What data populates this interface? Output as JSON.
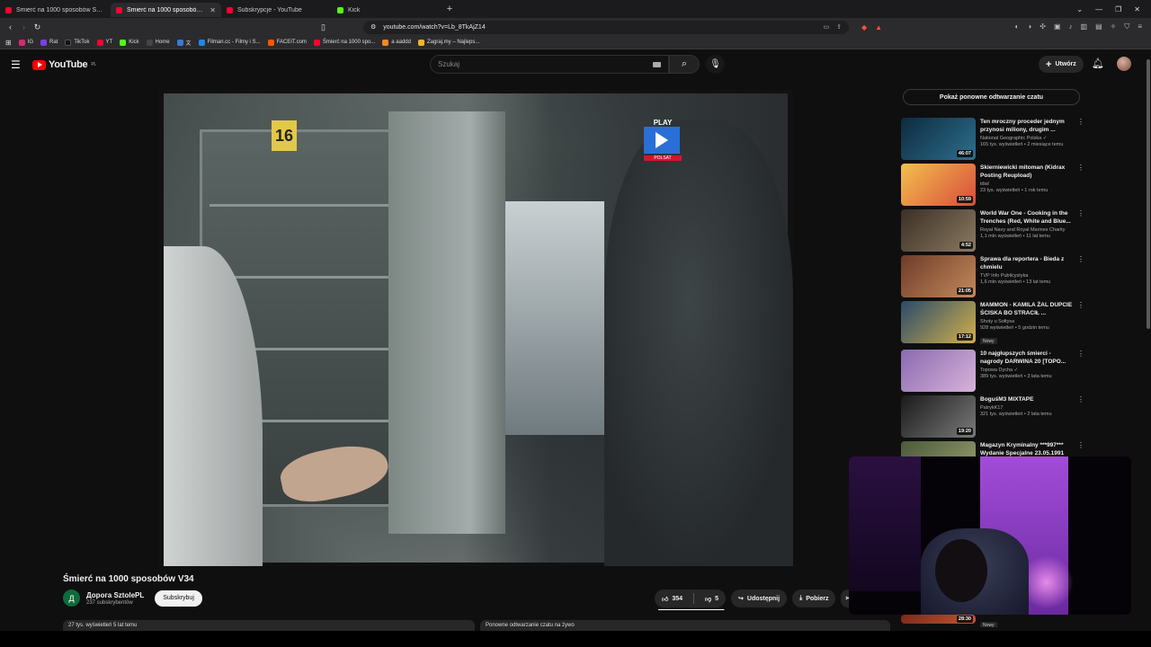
{
  "browser": {
    "tabs": [
      {
        "title": "Śmierć na 1000 sposobów S1 Odc. 2",
        "color": "#ff0033",
        "active": false
      },
      {
        "title": "Śmierć na 1000 sposobów V3",
        "color": "#ff0033",
        "active": true
      },
      {
        "title": "Subskrypcje - YouTube",
        "color": "#ff0033",
        "active": false
      },
      {
        "title": "Kick",
        "color": "#53fc18",
        "active": false
      }
    ],
    "new_tab": "+",
    "url": "youtube.com/watch?v=Lb_8TkAjZ14",
    "bookmarks": [
      {
        "label": "IG",
        "color": "#d62976"
      },
      {
        "label": "Rat",
        "color": "#7b3fe4"
      },
      {
        "label": "TikTok",
        "color": "#111111"
      },
      {
        "label": "YT",
        "color": "#ff0033"
      },
      {
        "label": "Kick",
        "color": "#53fc18"
      },
      {
        "label": "Home",
        "color": "#444444"
      },
      {
        "label": "文",
        "color": "#3a7bd5"
      },
      {
        "label": "Filman.cc - Filmy i S...",
        "color": "#1e88e5"
      },
      {
        "label": "FACEIT.com",
        "color": "#ff5500"
      },
      {
        "label": "Śmierć na 1000 spo...",
        "color": "#ff0033"
      },
      {
        "label": "a aaddd",
        "color": "#f08a24"
      },
      {
        "label": "Zagraj.my – Najleps...",
        "color": "#f0b429"
      }
    ]
  },
  "youtube": {
    "logo_text": "YouTube",
    "logo_region": "PL",
    "search_placeholder": "Szukaj",
    "create_label": "Utwórz"
  },
  "video": {
    "title": "Śmierć na 1000 sposobów V34",
    "channel_initial": "Д",
    "channel_name": "Дорога SztolePL",
    "subscribers": "237 subskrybentów",
    "subscribe_label": "Subskrybuj",
    "likes": "354",
    "dislikes": "5",
    "like_fraction": 0.986,
    "share_label": "Udostępnij",
    "download_label": "Pobierz",
    "description_snippet": "27 tys. wyświetleń  5 lat temu",
    "overlay_number": "16",
    "overlay_brand": "PLAY",
    "overlay_sub": "POLSAT"
  },
  "sidebar": {
    "replay_label": "Pokaż ponowne odtwarzanie czatu",
    "replay_bottom": "Ponowne odtwarzanie czatu na żywo",
    "recommendations": [
      {
        "title": "Ten mroczny proceder jednym przynosi miliony, drugim ...",
        "channel": "National Geographic Polska ✓",
        "views": "165 tys. wyświetleń • 2 miesiące temu",
        "duration": "46:07",
        "thumb_colors": [
          "#0d2b3e",
          "#2e6f8e"
        ]
      },
      {
        "title": "Skierniewicki mitoman (Kidrax Posting Reupload)",
        "channel": "tdwl",
        "views": "23 tys. wyświetleń • 1 rok temu",
        "duration": "10:59",
        "thumb_colors": [
          "#f2c14e",
          "#d94b3b"
        ]
      },
      {
        "title": "World War One - Cooking in the Trenches (Red, White and Blue...",
        "channel": "Royal Navy and Royal Marines Charity",
        "views": "1,1 mln wyświetleń • 11 lat temu",
        "duration": "4:52",
        "thumb_colors": [
          "#3b2f25",
          "#8a7a62"
        ]
      },
      {
        "title": "Sprawa dla reportera - Bieda z chmielu",
        "channel": "TVP Info Publicystyka",
        "views": "1,6 mln wyświetleń • 13 lat temu",
        "duration": "21:05",
        "thumb_colors": [
          "#6e3b2a",
          "#c48a5b"
        ]
      },
      {
        "title": "MAMMON -  KAMILA ŻAL DUPCIE ŚCISKA BO STRACIŁ ...",
        "channel": "Shoty u Sołtysa",
        "views": "928 wyświetleń • 5 godzin temu",
        "duration": "17:12",
        "badge": "Nowy",
        "thumb_colors": [
          "#2b4a6b",
          "#d1b04a"
        ]
      },
      {
        "title": "10 najgłupszych śmierci - nagrody DARWINA 20 [TOPO...",
        "channel": "Topowa Dycha ✓",
        "views": "389 tys. wyświetleń • 3 lata temu",
        "duration": "",
        "thumb_colors": [
          "#8a6ab0",
          "#d7b3d9"
        ]
      },
      {
        "title": "BoguśM3 MIXTAPE",
        "channel": "PatrykK17",
        "views": "321 tys. wyświetleń • 2 lata temu",
        "duration": "19:20",
        "thumb_colors": [
          "#1a1a1a",
          "#7a7a7a"
        ]
      },
      {
        "title": "Magazyn Kryminalny ***997*** Wydanie Specjalne 23.05.1991",
        "channel": "",
        "views": "",
        "duration": "",
        "thumb_colors": [
          "#4a5a3a",
          "#9aa070"
        ]
      }
    ],
    "bottom_duration": "28:30",
    "bottom_badge": "Nowy"
  }
}
